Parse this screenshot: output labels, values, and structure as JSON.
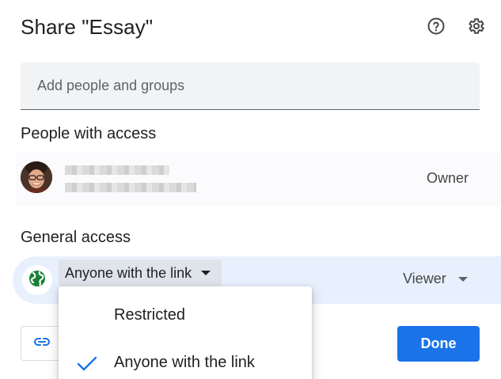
{
  "dialog": {
    "title": "Share \"Essay\"",
    "help_icon": "help-circle-icon",
    "settings_icon": "gear-icon"
  },
  "search": {
    "placeholder": "Add people and groups",
    "value": ""
  },
  "people_section": {
    "label": "People with access",
    "people": [
      {
        "role": "Owner",
        "avatar_icon": "user-avatar-photo"
      }
    ]
  },
  "general_access": {
    "label": "General access",
    "icon": "globe-icon",
    "selected_option": "Anyone with the link",
    "role": "Viewer"
  },
  "access_menu": {
    "options": [
      {
        "label": "Restricted",
        "checked": false
      },
      {
        "label": "Anyone with the link",
        "checked": true
      }
    ]
  },
  "footer": {
    "copy_link_icon": "link-icon",
    "done_label": "Done"
  },
  "colors": {
    "accent": "#1a73e8",
    "globe": "#188038",
    "access_row_bg": "#e8f0fe"
  }
}
